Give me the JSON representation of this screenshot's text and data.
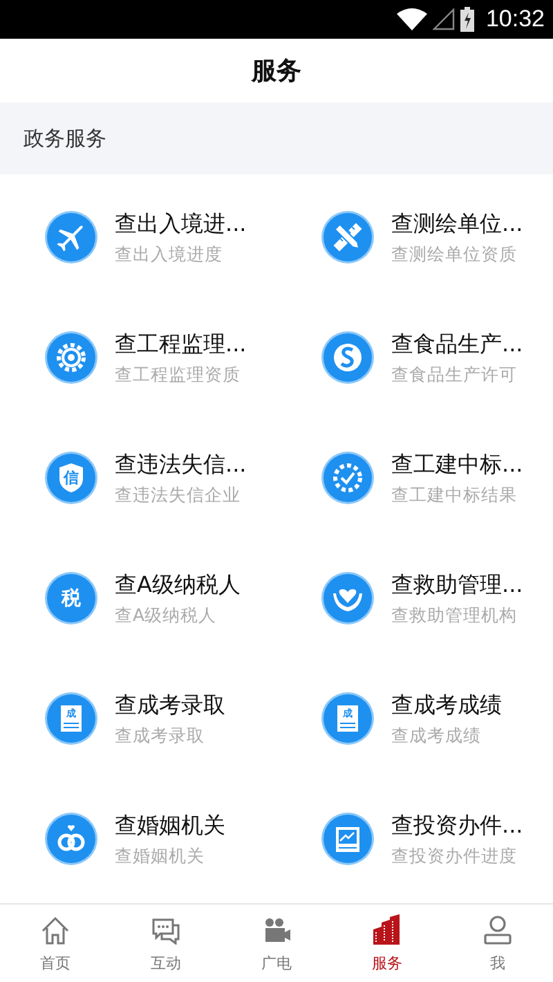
{
  "status_bar": {
    "time": "10:32"
  },
  "header": {
    "title": "服务"
  },
  "section": {
    "title": "政务服务"
  },
  "services": [
    {
      "title": "查出入境进...",
      "subtitle": "查出入境进度"
    },
    {
      "title": "查测绘单位...",
      "subtitle": "查测绘单位资质"
    },
    {
      "title": "查工程监理...",
      "subtitle": "查工程监理资质"
    },
    {
      "title": "查食品生产...",
      "subtitle": "查食品生产许可"
    },
    {
      "title": "查违法失信...",
      "subtitle": "查违法失信企业",
      "icon_text": "信"
    },
    {
      "title": "查工建中标...",
      "subtitle": "查工建中标结果"
    },
    {
      "title": "查A级纳税人",
      "subtitle": "查A级纳税人",
      "icon_text": "税"
    },
    {
      "title": "查救助管理...",
      "subtitle": "查救助管理机构"
    },
    {
      "title": "查成考录取",
      "subtitle": "查成考录取",
      "icon_text": "成"
    },
    {
      "title": "查成考成绩",
      "subtitle": "查成考成绩",
      "icon_text": "成"
    },
    {
      "title": "查婚姻机关",
      "subtitle": "查婚姻机关"
    },
    {
      "title": "查投资办件...",
      "subtitle": "查投资办件进度"
    }
  ],
  "tab_bar": [
    {
      "label": "首页",
      "selected": false
    },
    {
      "label": "互动",
      "selected": false
    },
    {
      "label": "广电",
      "selected": false
    },
    {
      "label": "服务",
      "selected": true
    },
    {
      "label": "我",
      "selected": false
    }
  ]
}
